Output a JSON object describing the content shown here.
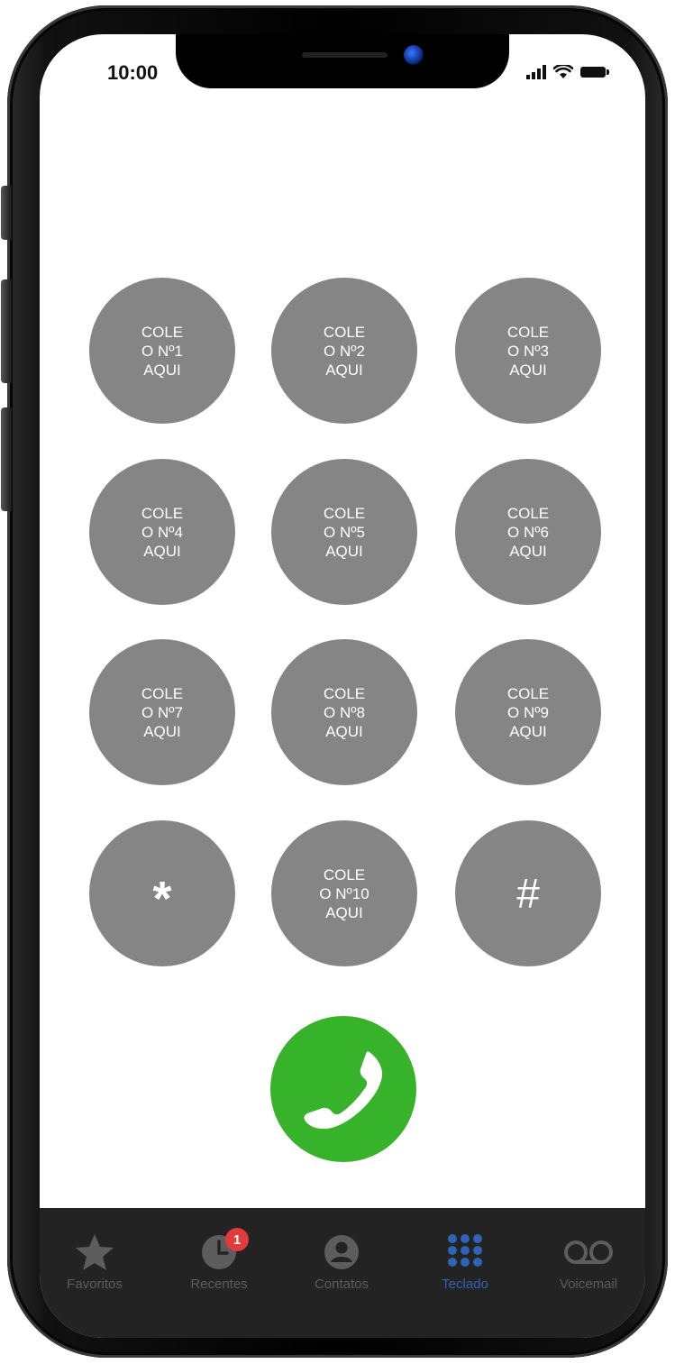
{
  "status_bar": {
    "time": "10:00"
  },
  "keypad": {
    "keys": [
      {
        "label": "COLE\nO Nº1\nAQUI"
      },
      {
        "label": "COLE\nO Nº2\nAQUI"
      },
      {
        "label": "COLE\nO Nº3\nAQUI"
      },
      {
        "label": "COLE\nO Nº4\nAQUI"
      },
      {
        "label": "COLE\nO Nº5\nAQUI"
      },
      {
        "label": "COLE\nO Nº6\nAQUI"
      },
      {
        "label": "COLE\nO Nº7\nAQUI"
      },
      {
        "label": "COLE\nO Nº8\nAQUI"
      },
      {
        "label": "COLE\nO Nº9\nAQUI"
      },
      {
        "label": "*"
      },
      {
        "label": "COLE\nO Nº10\nAQUI"
      },
      {
        "label": "#"
      }
    ],
    "key_color": "#858585",
    "call_color": "#36b22b"
  },
  "tab_bar": {
    "tabs": [
      {
        "label": "Favoritos",
        "icon": "star-icon"
      },
      {
        "label": "Recentes",
        "icon": "clock-icon",
        "badge": "1"
      },
      {
        "label": "Contatos",
        "icon": "person-circle-icon"
      },
      {
        "label": "Teclado",
        "icon": "keypad-grid-icon",
        "active": true
      },
      {
        "label": "Voicemail",
        "icon": "voicemail-icon"
      }
    ],
    "active_color": "#2e63b8"
  }
}
